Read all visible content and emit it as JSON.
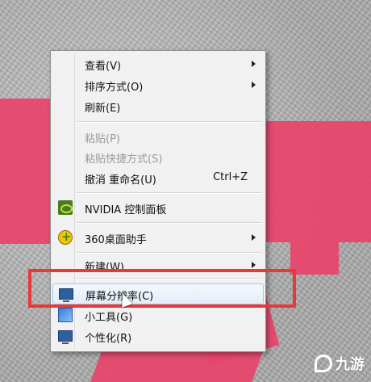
{
  "menu": {
    "items": [
      {
        "label": "查看(V)",
        "submenu": true
      },
      {
        "label": "排序方式(O)",
        "submenu": true
      },
      {
        "label": "刷新(E)"
      },
      {
        "label": "粘贴(P)",
        "disabled": true
      },
      {
        "label": "粘贴快捷方式(S)",
        "disabled": true
      },
      {
        "label": "撤消 重命名(U)",
        "accel": "Ctrl+Z"
      },
      {
        "label": "NVIDIA 控制面板",
        "icon": "nvidia-icon"
      },
      {
        "label": "360桌面助手",
        "icon": "360-icon",
        "submenu": true
      },
      {
        "label": "新建(W)",
        "submenu": true
      },
      {
        "label": "屏幕分辨率(C)",
        "icon": "monitor-icon",
        "hovered": true
      },
      {
        "label": "小工具(G)",
        "icon": "gadget-icon"
      },
      {
        "label": "个性化(R)",
        "icon": "monitor-icon"
      }
    ]
  },
  "watermark": {
    "text": "九游"
  },
  "colors": {
    "highlight": "#e8393a",
    "desktop_shape": "#e8436a"
  }
}
